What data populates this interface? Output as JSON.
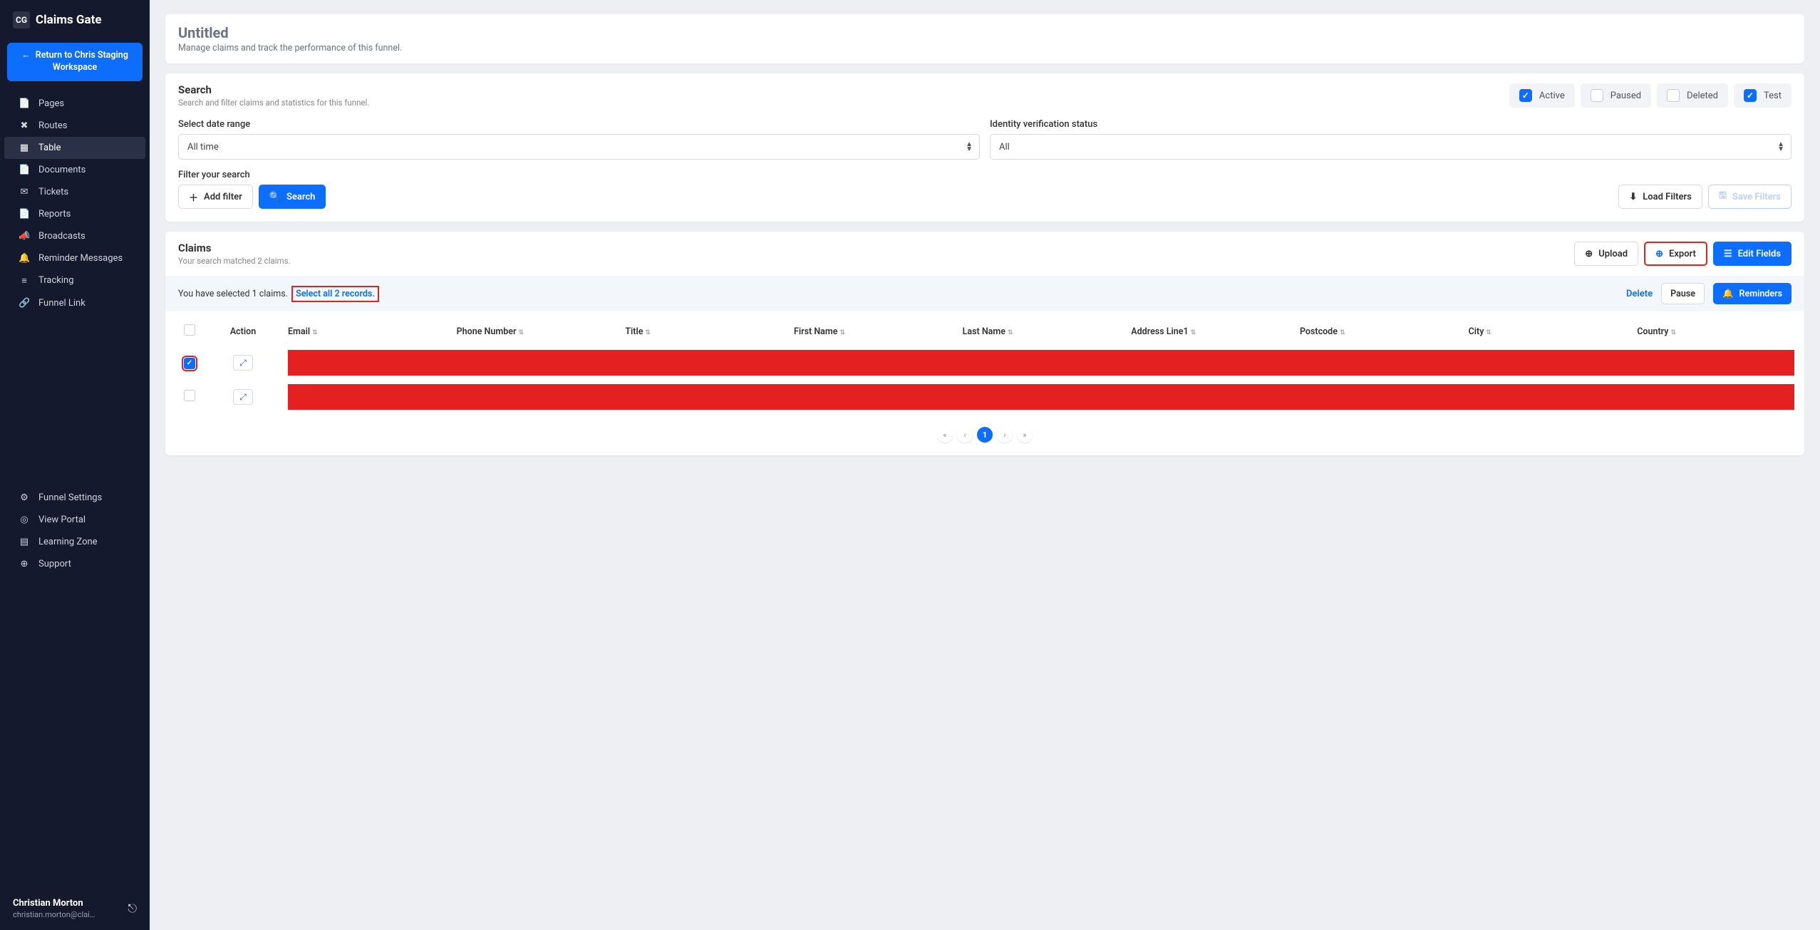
{
  "brand": {
    "logo_text": "CG",
    "name": "Claims Gate"
  },
  "return_button": "Return to Chris Staging Workspace",
  "nav": {
    "main": [
      {
        "icon": "📄",
        "label": "Pages"
      },
      {
        "icon": "✖",
        "label": "Routes"
      },
      {
        "icon": "▦",
        "label": "Table",
        "active": true
      },
      {
        "icon": "📄",
        "label": "Documents"
      },
      {
        "icon": "✉",
        "label": "Tickets"
      },
      {
        "icon": "📄",
        "label": "Reports"
      },
      {
        "icon": "📣",
        "label": "Broadcasts"
      },
      {
        "icon": "🔔",
        "label": "Reminder Messages"
      },
      {
        "icon": "≡",
        "label": "Tracking"
      },
      {
        "icon": "🔗",
        "label": "Funnel Link"
      }
    ],
    "bottom": [
      {
        "icon": "⚙",
        "label": "Funnel Settings"
      },
      {
        "icon": "◎",
        "label": "View Portal"
      },
      {
        "icon": "▤",
        "label": "Learning Zone"
      },
      {
        "icon": "⊕",
        "label": "Support"
      }
    ]
  },
  "user": {
    "name": "Christian Morton",
    "email": "christian.morton@claims..."
  },
  "header": {
    "title": "Untitled",
    "subtitle": "Manage claims and track the performance of this funnel."
  },
  "search": {
    "title": "Search",
    "subtitle": "Search and filter claims and statistics for this funnel.",
    "statuses": [
      {
        "label": "Active",
        "checked": true
      },
      {
        "label": "Paused",
        "checked": false
      },
      {
        "label": "Deleted",
        "checked": false
      },
      {
        "label": "Test",
        "checked": true
      }
    ],
    "date_label": "Select date range",
    "date_value": "All time",
    "identity_label": "Identity verification status",
    "identity_value": "All",
    "filter_label": "Filter your search",
    "add_filter": "Add filter",
    "search_btn": "Search",
    "load_filters": "Load Filters",
    "save_filters": "Save Filters"
  },
  "claims": {
    "title": "Claims",
    "subtitle": "Your search matched 2 claims.",
    "upload": "Upload",
    "export": "Export",
    "edit_fields": "Edit Fields",
    "selection_text": "You have selected 1 claims.",
    "select_all_link": "Select all 2 records.",
    "delete": "Delete",
    "pause": "Pause",
    "reminders": "Reminders",
    "columns": [
      "Action",
      "Email",
      "Phone Number",
      "Title",
      "First Name",
      "Last Name",
      "Address Line1",
      "Postcode",
      "City",
      "Country"
    ],
    "rows": [
      {
        "checked": true
      },
      {
        "checked": false
      }
    ]
  },
  "pagination": {
    "current": "1"
  }
}
